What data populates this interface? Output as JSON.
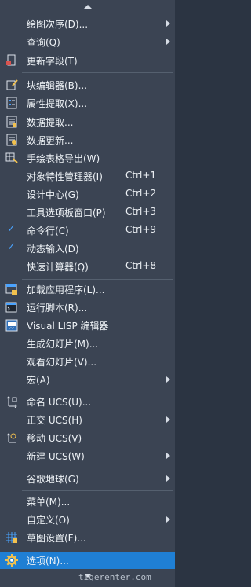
{
  "menu": {
    "items": [
      {
        "label": "绘图次序(D)...",
        "submenu": true
      },
      {
        "label": "查询(Q)",
        "submenu": true
      },
      {
        "label": "更新字段(T)",
        "icon": "update-field-icon"
      },
      {
        "label": "块编辑器(B)...",
        "icon": "block-editor-icon"
      },
      {
        "label": "属性提取(X)...",
        "icon": "attribute-extract-icon"
      },
      {
        "label": "数据提取...",
        "icon": "data-extract-icon"
      },
      {
        "label": "数据更新...",
        "icon": "data-update-icon"
      },
      {
        "label": "手绘表格导出(W)",
        "icon": "table-export-icon"
      },
      {
        "label": "对象特性管理器(I)",
        "shortcut": "Ctrl+1"
      },
      {
        "label": "设计中心(G)",
        "shortcut": "Ctrl+2"
      },
      {
        "label": "工具选项板窗口(P)",
        "shortcut": "Ctrl+3"
      },
      {
        "label": "命令行(C)",
        "shortcut": "Ctrl+9",
        "checked": true
      },
      {
        "label": "动态输入(D)",
        "checked": true
      },
      {
        "label": "快速计算器(Q)",
        "shortcut": "Ctrl+8"
      },
      {
        "label": "加载应用程序(L)...",
        "icon": "load-app-icon"
      },
      {
        "label": "运行脚本(R)...",
        "icon": "run-script-icon"
      },
      {
        "label": "Visual LISP 编辑器",
        "icon": "lisp-icon"
      },
      {
        "label": "生成幻灯片(M)..."
      },
      {
        "label": "观看幻灯片(V)..."
      },
      {
        "label": "宏(A)",
        "submenu": true
      },
      {
        "label": "命名 UCS(U)...",
        "icon": "named-ucs-icon"
      },
      {
        "label": "正交 UCS(H)",
        "submenu": true
      },
      {
        "label": "移动 UCS(V)",
        "icon": "move-ucs-icon"
      },
      {
        "label": "新建 UCS(W)",
        "submenu": true
      },
      {
        "label": "谷歌地球(G)",
        "submenu": true
      },
      {
        "label": "菜单(M)..."
      },
      {
        "label": "自定义(O)",
        "submenu": true
      },
      {
        "label": "草图设置(F)...",
        "icon": "drafting-settings-icon"
      },
      {
        "label": "选项(N)...",
        "icon": "options-gear-icon",
        "selected": true
      }
    ]
  },
  "watermark": "tigerenter.com",
  "colors": {
    "background": "#3b4453",
    "selected": "#1f7fd4",
    "check": "#4aa3ff"
  }
}
